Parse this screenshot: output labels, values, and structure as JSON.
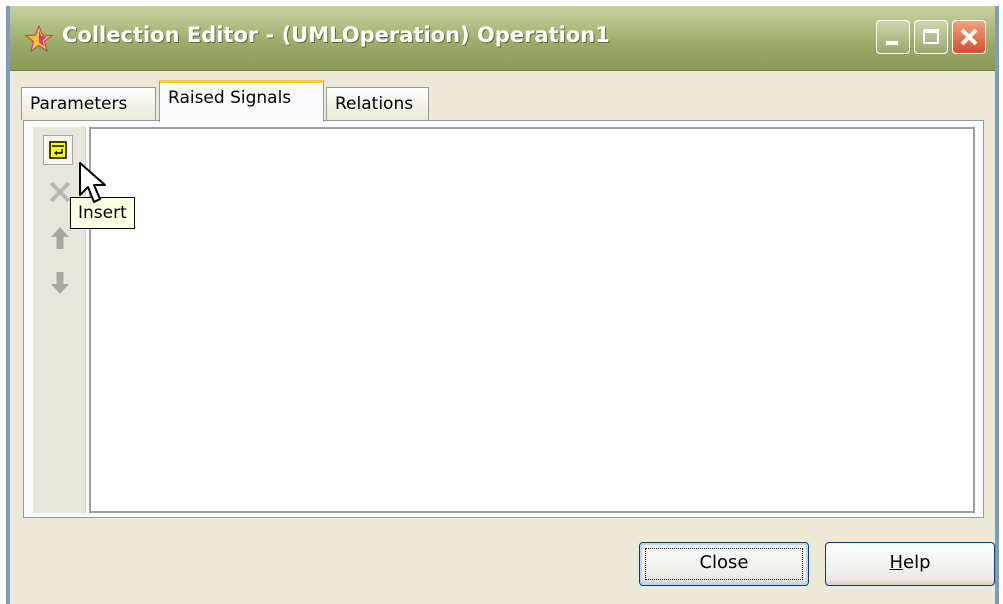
{
  "window": {
    "title": "Collection Editor - (UMLOperation) Operation1",
    "title_icon": "star-icon",
    "controls": [
      "minimize-icon",
      "maximize-icon",
      "close-icon"
    ]
  },
  "tabs": [
    {
      "label": "Parameters",
      "active": false
    },
    {
      "label": "Raised Signals",
      "active": true
    },
    {
      "label": "Relations",
      "active": false
    }
  ],
  "toolbar": {
    "buttons": [
      {
        "icon": "insert-icon",
        "enabled": true
      },
      {
        "icon": "delete-icon",
        "enabled": false
      },
      {
        "icon": "move-up-icon",
        "enabled": false
      },
      {
        "icon": "move-down-icon",
        "enabled": false
      }
    ]
  },
  "tooltip": {
    "text": "Insert"
  },
  "footer": {
    "close_label": "Close",
    "help_label_prefix": "",
    "help_label_accel": "H",
    "help_label_rest": "elp"
  },
  "colors": {
    "titlebar": "#97a764",
    "window_bg": "#ece9d8",
    "active_tab_accent": "#ffc83c",
    "tooltip_bg": "#ffffe1",
    "insert_icon": "#ffff00"
  }
}
